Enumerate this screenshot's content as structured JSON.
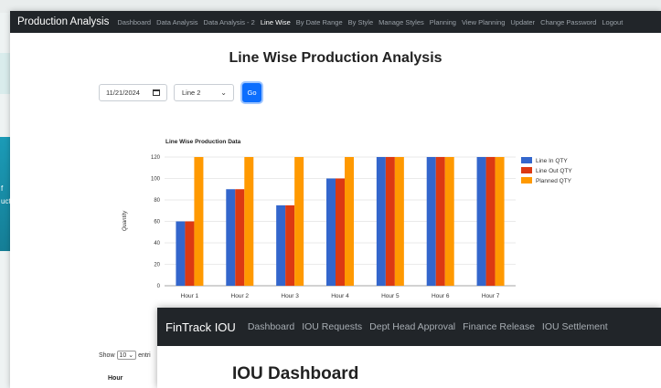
{
  "nav": {
    "brand": "Production Analysis",
    "links": [
      "Dashboard",
      "Data Analysis",
      "Data Analysis - 2",
      "Line Wise",
      "By Date Range",
      "By Style",
      "Manage Styles",
      "Planning",
      "View Planning",
      "Updater",
      "Change Password",
      "Logout"
    ],
    "active": "Line Wise"
  },
  "page": {
    "title": "Line Wise Production Analysis"
  },
  "controls": {
    "date": "11/21/2024",
    "line": "Line 2",
    "go": "Go"
  },
  "chart_data": {
    "type": "bar",
    "title": "Line Wise Production Data",
    "ylabel": "Quantity",
    "xlabel": "",
    "categories": [
      "Hour 1",
      "Hour 2",
      "Hour 3",
      "Hour 4",
      "Hour 5",
      "Hour 6",
      "Hour 7"
    ],
    "series": [
      {
        "name": "Line In QTY",
        "values": [
          60,
          90,
          75,
          100,
          120,
          120,
          120
        ],
        "color": "#3366cc"
      },
      {
        "name": "Line Out QTY",
        "values": [
          60,
          90,
          75,
          100,
          120,
          120,
          120
        ],
        "color": "#dc3912"
      },
      {
        "name": "Planned QTY",
        "values": [
          120,
          120,
          120,
          120,
          120,
          120,
          120
        ],
        "color": "#ff9900"
      }
    ],
    "ylim": [
      0,
      120
    ],
    "yticks": [
      0,
      20,
      40,
      60,
      80,
      100,
      120
    ],
    "grid": true,
    "legend": "right"
  },
  "table": {
    "show_label": "Show",
    "show_value": "10",
    "entries_label": "entri",
    "header_hour": "Hour"
  },
  "background": {
    "side_text_1": "f",
    "side_text_2": "uct"
  },
  "overlay": {
    "brand": "FinTrack IOU",
    "links": [
      "Dashboard",
      "IOU Requests",
      "Dept Head Approval",
      "Finance Release",
      "IOU Settlement"
    ],
    "title": "IOU Dashboard"
  }
}
